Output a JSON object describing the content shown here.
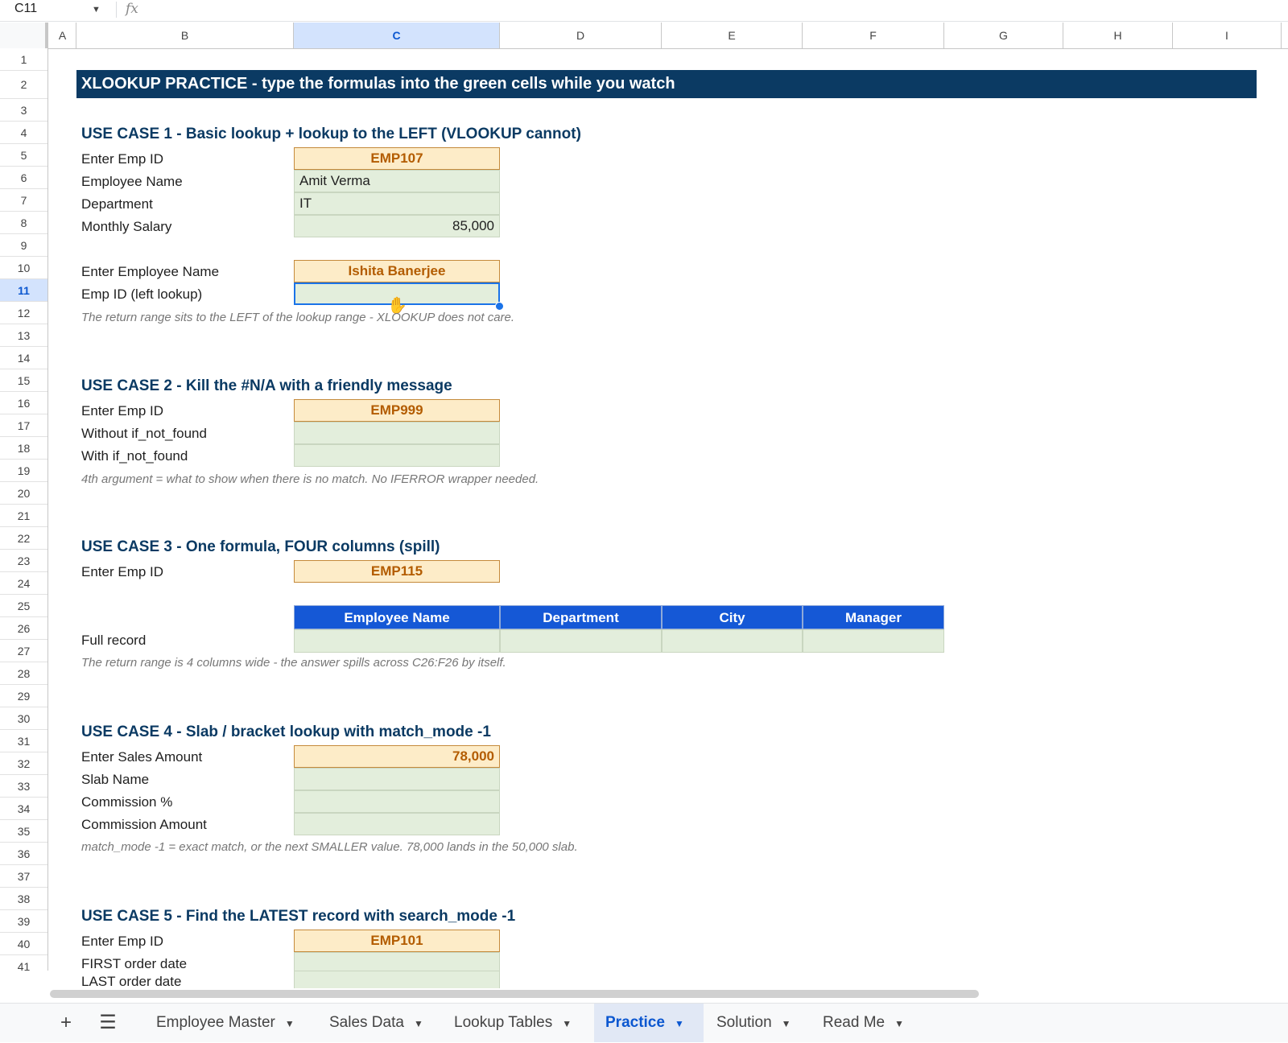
{
  "formula_bar": {
    "name_box": "C11",
    "fx_icon": "fx"
  },
  "columns": [
    "A",
    "B",
    "C",
    "D",
    "E",
    "F",
    "G",
    "H",
    "I"
  ],
  "rows": [
    "1",
    "2",
    "3",
    "4",
    "5",
    "6",
    "7",
    "8",
    "9",
    "10",
    "11",
    "12",
    "13",
    "14",
    "15",
    "16",
    "17",
    "18",
    "19",
    "20",
    "21",
    "22",
    "23",
    "24",
    "25",
    "26",
    "27",
    "28",
    "29",
    "30",
    "31",
    "32",
    "33",
    "34",
    "35",
    "36",
    "37",
    "38",
    "39",
    "40",
    "41"
  ],
  "selected_cell": {
    "column": "C",
    "row": "11"
  },
  "banner": "XLOOKUP PRACTICE  -  type the formulas into the green cells while you watch",
  "use_case_1": {
    "heading": "USE CASE 1  -  Basic lookup + lookup to the LEFT (VLOOKUP cannot)",
    "emp_id_label": "Enter Emp ID",
    "emp_id_value": "EMP107",
    "name_label": "Employee Name",
    "name_value": "Amit Verma",
    "dept_label": "Department",
    "dept_value": "IT",
    "salary_label": "Monthly Salary",
    "salary_value": "85,000",
    "emp_name_label": "Enter Employee Name",
    "emp_name_value": "Ishita Banerjee",
    "left_lookup_label": "Emp ID  (left lookup)",
    "note": "The return range sits to the LEFT of the lookup range - XLOOKUP does not care."
  },
  "use_case_2": {
    "heading": "USE CASE 2  -  Kill the #N/A with a friendly message",
    "emp_id_label": "Enter Emp ID",
    "emp_id_value": "EMP999",
    "without_label": "Without if_not_found",
    "with_label": "With if_not_found",
    "note": "4th argument = what to show when there is no match. No IFERROR wrapper needed."
  },
  "use_case_3": {
    "heading": "USE CASE 3  -  One formula, FOUR columns (spill)",
    "emp_id_label": "Enter Emp ID",
    "emp_id_value": "EMP115",
    "table_headers": [
      "Employee Name",
      "Department",
      "City",
      "Manager"
    ],
    "full_record_label": "Full record",
    "note": "The return range is 4 columns wide - the answer spills across C26:F26 by itself."
  },
  "use_case_4": {
    "heading": "USE CASE 4  -  Slab / bracket lookup with match_mode -1",
    "sales_label": "Enter Sales Amount",
    "sales_value": "78,000",
    "slab_label": "Slab Name",
    "comm_pct_label": "Commission %",
    "comm_amt_label": "Commission Amount",
    "note": "match_mode -1 = exact match, or the next SMALLER value. 78,000 lands in the 50,000 slab."
  },
  "use_case_5": {
    "heading": "USE CASE 5  -  Find the LATEST record with search_mode -1",
    "emp_id_label": "Enter Emp ID",
    "emp_id_value": "EMP101",
    "first_label": "FIRST order date",
    "last_label": "LAST order date"
  },
  "tabs": [
    {
      "label": "Employee Master",
      "active": false
    },
    {
      "label": "Sales Data",
      "active": false
    },
    {
      "label": "Lookup Tables",
      "active": false
    },
    {
      "label": "Practice",
      "active": true
    },
    {
      "label": "Solution",
      "active": false
    },
    {
      "label": "Read Me",
      "active": false
    }
  ],
  "icons": {
    "add_sheet": "plus-icon",
    "all_sheets": "menu-icon",
    "dropdown": "chevron-down-icon"
  }
}
